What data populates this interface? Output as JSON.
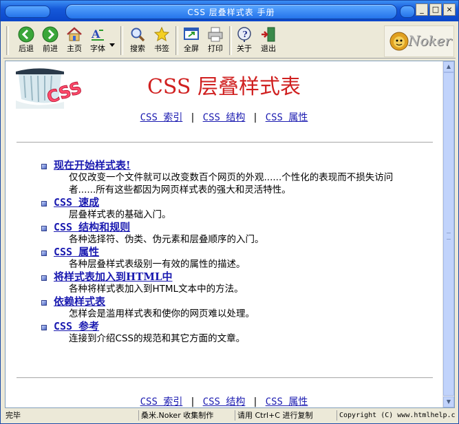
{
  "window": {
    "title": "CSS  层叠样式表  手册",
    "controls": {
      "minimize": "_",
      "maximize": "□",
      "close": "×"
    }
  },
  "toolbar": {
    "buttons": [
      {
        "label": "后退",
        "icon": "back-arrow-icon"
      },
      {
        "label": "前进",
        "icon": "forward-arrow-icon"
      },
      {
        "label": "主页",
        "icon": "home-icon"
      },
      {
        "label": "字体",
        "icon": "font-icon"
      },
      {
        "label": "搜索",
        "icon": "search-icon"
      },
      {
        "label": "书签",
        "icon": "star-icon"
      },
      {
        "label": "全屏",
        "icon": "fullscreen-icon"
      },
      {
        "label": "打印",
        "icon": "printer-icon"
      },
      {
        "label": "关于",
        "icon": "info-icon"
      },
      {
        "label": "退出",
        "icon": "exit-door-icon"
      }
    ],
    "logo_text": "Noker"
  },
  "page": {
    "title": "CSS 层叠样式表",
    "nav": {
      "index": "CSS 索引",
      "structure": "CSS 结构",
      "properties": "CSS 属性",
      "separator": "|"
    },
    "toc": [
      {
        "link": "现在开始样式表!",
        "desc": "仅仅改变一个文件就可以改变数百个网页的外观......个性化的表现而不损失访问者......所有这些都因为网页样式表的强大和灵活特性。",
        "mono": false
      },
      {
        "link": "CSS 速成",
        "desc": "层叠样式表的基础入门。",
        "mono": true
      },
      {
        "link": "CSS 结构和规则",
        "desc": "各种选择符、伪类、伪元素和层叠顺序的入门。",
        "mono": true
      },
      {
        "link": "CSS 属性",
        "desc": "各种层叠样式表级别一有效的属性的描述。",
        "mono": true
      },
      {
        "link": "将样式表加入到HTML中",
        "desc": "各种将样式表加入到HTML文本中的方法。",
        "mono": false
      },
      {
        "link": "依赖样式表",
        "desc": "怎样会是滥用样式表和使你的网页难以处理。",
        "mono": false
      },
      {
        "link": "CSS 参考",
        "desc": "连接到介绍CSS的规范和其它方面的文章。",
        "mono": true
      }
    ]
  },
  "status": {
    "state": "完毕",
    "collector": "桑米.Noker 收集制作",
    "copy_hint": "请用 Ctrl+C 进行复制",
    "copyright": "Copyright (C) www.htmlhelp.c"
  },
  "colors": {
    "title_red": "#d02020",
    "link_blue": "#1a1ab0",
    "titlebar_blue": "#1559d9",
    "chrome": "#ece9d8"
  }
}
